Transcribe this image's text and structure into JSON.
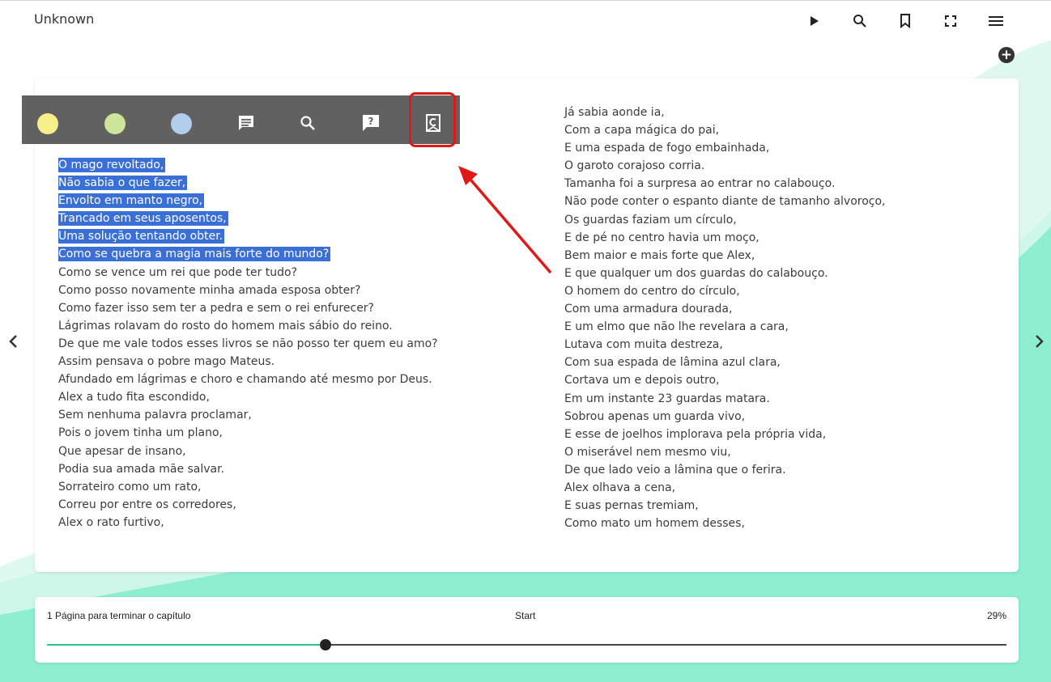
{
  "app": {
    "title": "Unknown"
  },
  "toolbar": [
    {
      "name": "play-icon"
    },
    {
      "name": "search-icon"
    },
    {
      "name": "bookmark-icon"
    },
    {
      "name": "fullscreen-icon"
    },
    {
      "name": "menu-icon"
    }
  ],
  "add_button": {
    "label": "+"
  },
  "popup": {
    "colors": [
      "#f7f08a",
      "#cde49a",
      "#b3cdec"
    ],
    "icons": [
      "note-icon",
      "search-icon",
      "question-icon",
      "bookmark-c-icon"
    ]
  },
  "page": {
    "left_lines": [
      {
        "text": "O mago revoltado,",
        "highlighted": true
      },
      {
        "text": "Não sabia o que fazer,",
        "highlighted": true
      },
      {
        "text": "Envolto em manto negro,",
        "highlighted": true
      },
      {
        "text": "Trancado em seus aposentos,",
        "highlighted": true
      },
      {
        "text": "Uma solução tentando obter.",
        "highlighted": true
      },
      {
        "text": "Como se quebra a magia mais forte do mundo?",
        "highlighted": true
      },
      {
        "text": "Como se vence um rei que pode ter tudo?",
        "highlighted": false
      },
      {
        "text": "Como posso novamente minha amada esposa obter?",
        "highlighted": false
      },
      {
        "text": "Como fazer isso sem ter a pedra e sem o rei enfurecer?",
        "highlighted": false
      },
      {
        "text": "Lágrimas rolavam do rosto do homem mais sábio do reino.",
        "highlighted": false
      },
      {
        "text": "De que me vale todos esses livros se não posso ter quem eu amo?",
        "highlighted": false
      },
      {
        "text": "Assim pensava o pobre mago Mateus.",
        "highlighted": false
      },
      {
        "text": "Afundado em lágrimas e choro e chamando até mesmo por Deus.",
        "highlighted": false
      },
      {
        "text": "Alex a tudo fita escondido,",
        "highlighted": false
      },
      {
        "text": "Sem nenhuma palavra proclamar,",
        "highlighted": false
      },
      {
        "text": "Pois o jovem tinha um plano,",
        "highlighted": false
      },
      {
        "text": "Que apesar de insano,",
        "highlighted": false
      },
      {
        "text": "Podia sua amada mãe salvar.",
        "highlighted": false
      },
      {
        "text": "Sorrateiro como um rato,",
        "highlighted": false
      },
      {
        "text": "Correu por entre os corredores,",
        "highlighted": false
      },
      {
        "text": "Alex o rato furtivo,",
        "highlighted": false
      }
    ],
    "right_lines": [
      "Já sabia aonde ia,",
      "Com a capa mágica do pai,",
      "E uma espada de fogo embainhada,",
      "O garoto corajoso corria.",
      "Tamanha foi a surpresa ao entrar no calabouço.",
      "Não pode conter o espanto diante de tamanho alvoroço,",
      "Os guardas faziam um círculo,",
      "E de pé no centro havia um moço,",
      "Bem maior e mais forte que Alex,",
      "E que qualquer um dos guardas do calabouço.",
      "O homem do centro do círculo,",
      "Com uma armadura dourada,",
      "E um elmo que não lhe revelara a cara,",
      "Lutava com muita destreza,",
      "Com sua espada de lâmina azul clara,",
      "Cortava um e depois outro,",
      "Em um instante 23 guardas matara.",
      "Sobrou apenas um guarda vivo,",
      "E esse de joelhos implorava pela própria vida,",
      "O miserável nem mesmo viu,",
      "De que lado veio a lâmina que o ferira.",
      "Alex olhava a cena,",
      "E suas pernas tremiam,",
      "Como mato um homem desses,"
    ]
  },
  "progress": {
    "chapter_text": "1 Página para terminar o capítulo",
    "start_label": "Start",
    "percent_label": "29%",
    "value": 0.29
  },
  "colors": {
    "accent": "#2fc28a",
    "highlight": "#3b6fd8",
    "annotation": "#e11818"
  }
}
